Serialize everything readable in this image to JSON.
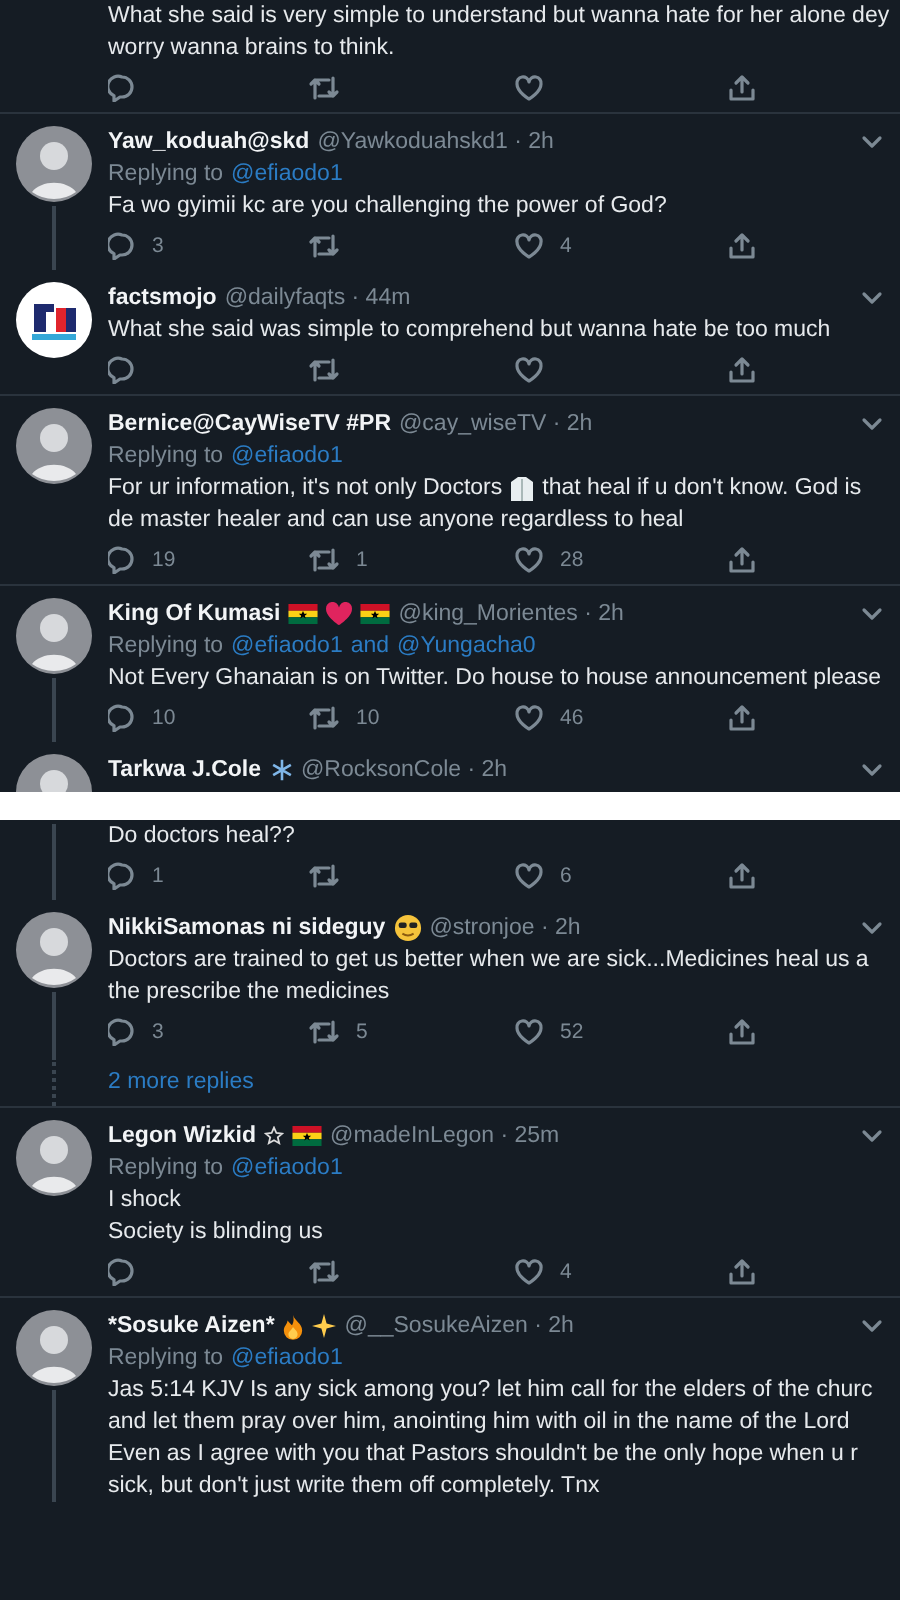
{
  "panels": [
    {
      "items": [
        {
          "kind": "continuation",
          "thread": false,
          "body": [
            [
              {
                "kind": "text",
                "text": "What she said is very simple to understand but wanna hate for her alone dey"
              }
            ],
            [
              {
                "kind": "text",
                "text": "worry wanna brains to think."
              }
            ]
          ]
        },
        {
          "kind": "tweet",
          "avatar": {
            "kind": "person"
          },
          "thread": true,
          "name": "Yaw_koduah@skd",
          "handle": "@Yawkoduahskd1 · 2h",
          "replying": {
            "label": "Replying to",
            "mentions": [
              "@efiaodo1"
            ]
          },
          "body": [
            [
              {
                "kind": "text",
                "text": "Fa wo gyimii kc are you challenging the power of God?"
              }
            ]
          ],
          "actions": {
            "reply": "3",
            "like": "4"
          }
        },
        {
          "kind": "tweet",
          "avatar": {
            "kind": "logo"
          },
          "thread": false,
          "name": "factsmojo",
          "handle": "@dailyfaqts · 44m",
          "body": [
            [
              {
                "kind": "text",
                "text": "What she said was simple to comprehend but wanna hate be too much"
              }
            ]
          ]
        },
        {
          "kind": "tweet",
          "avatar": {
            "kind": "person"
          },
          "thread": false,
          "name": "Bernice@CayWiseTV #PR",
          "handle": "@cay_wiseTV · 2h",
          "replying": {
            "label": "Replying to",
            "mentions": [
              "@efiaodo1"
            ]
          },
          "body": [
            [
              {
                "kind": "text",
                "text": "For ur information, it's not only Doctors"
              },
              {
                "kind": "coat"
              },
              {
                "kind": "text",
                "text": "that heal  if u don't know. God is"
              }
            ],
            [
              {
                "kind": "text",
                "text": "de master healer and can use anyone regardless to heal"
              }
            ]
          ],
          "actions": {
            "reply": "19",
            "retweet": "1",
            "like": "28"
          }
        },
        {
          "kind": "tweet",
          "avatar": {
            "kind": "person"
          },
          "thread": true,
          "name": "King Of Kumasi",
          "badges": [
            {
              "kind": "flag"
            },
            {
              "kind": "heart"
            },
            {
              "kind": "flag"
            }
          ],
          "handle": "@king_Morientes · 2h",
          "replying": {
            "label": "Replying to",
            "mentions": [
              "@efiaodo1",
              "and",
              "@Yungacha0"
            ]
          },
          "body": [
            [
              {
                "kind": "text",
                "text": "Not Every Ghanaian is on Twitter. Do house to house announcement please"
              }
            ]
          ],
          "actions": {
            "reply": "10",
            "retweet": "10",
            "like": "46"
          }
        },
        {
          "kind": "header",
          "avatar": {
            "kind": "person"
          },
          "thread": false,
          "name": "Tarkwa J.Cole",
          "badges": [
            {
              "kind": "snowflake"
            }
          ],
          "handle": "@RocksonCole · 2h"
        }
      ]
    },
    {
      "items": [
        {
          "kind": "continuation",
          "thread": true,
          "body": [
            [
              {
                "kind": "text",
                "text": "Do doctors heal??"
              }
            ]
          ],
          "actions": {
            "reply": "1",
            "like": "6"
          }
        },
        {
          "kind": "tweet",
          "avatar": {
            "kind": "person"
          },
          "thread": true,
          "name": "NikkiSamonas ni sideguy",
          "badges": [
            {
              "kind": "sunglasses"
            }
          ],
          "handle": "@stronjoe · 2h",
          "body": [
            [
              {
                "kind": "text",
                "text": "Doctors are trained to get us better when we are sick...Medicines heal us a"
              }
            ],
            [
              {
                "kind": "text",
                "text": "the prescribe the medicines"
              }
            ]
          ],
          "actions": {
            "reply": "3",
            "retweet": "5",
            "like": "52"
          }
        },
        {
          "kind": "more",
          "text": "2 more replies"
        },
        {
          "kind": "tweet",
          "avatar": {
            "kind": "person"
          },
          "thread": false,
          "name": "Legon Wizkid",
          "badges": [
            {
              "kind": "star"
            },
            {
              "kind": "flag"
            }
          ],
          "handle": "@madeInLegon · 25m",
          "replying": {
            "label": "Replying to",
            "mentions": [
              "@efiaodo1"
            ]
          },
          "body": [
            [
              {
                "kind": "text",
                "text": "I shock"
              }
            ],
            [
              {
                "kind": "text",
                "text": "Society is blinding us"
              }
            ]
          ],
          "actions": {
            "like": "4"
          }
        },
        {
          "kind": "clipped",
          "avatar": {
            "kind": "person"
          },
          "thread": true,
          "name": "*Sosuke Aizen*",
          "badges": [
            {
              "kind": "fire"
            },
            {
              "kind": "sparkle"
            }
          ],
          "handle": "@__SosukeAizen · 2h",
          "replying": {
            "label": "Replying to",
            "mentions": [
              "@efiaodo1"
            ]
          },
          "body": [
            [
              {
                "kind": "text",
                "text": "Jas 5:14 KJV Is any sick among you? let him call for the elders of the churc"
              }
            ],
            [
              {
                "kind": "text",
                "text": "and let them pray over him, anointing him with oil in the name of the Lord"
              }
            ],
            [
              {
                "kind": "text",
                "text": "Even as I agree with you that Pastors shouldn't be the only hope when u r"
              }
            ],
            [
              {
                "kind": "text",
                "text": "sick, but don't just write them off completely. Tnx"
              }
            ]
          ]
        }
      ]
    }
  ]
}
